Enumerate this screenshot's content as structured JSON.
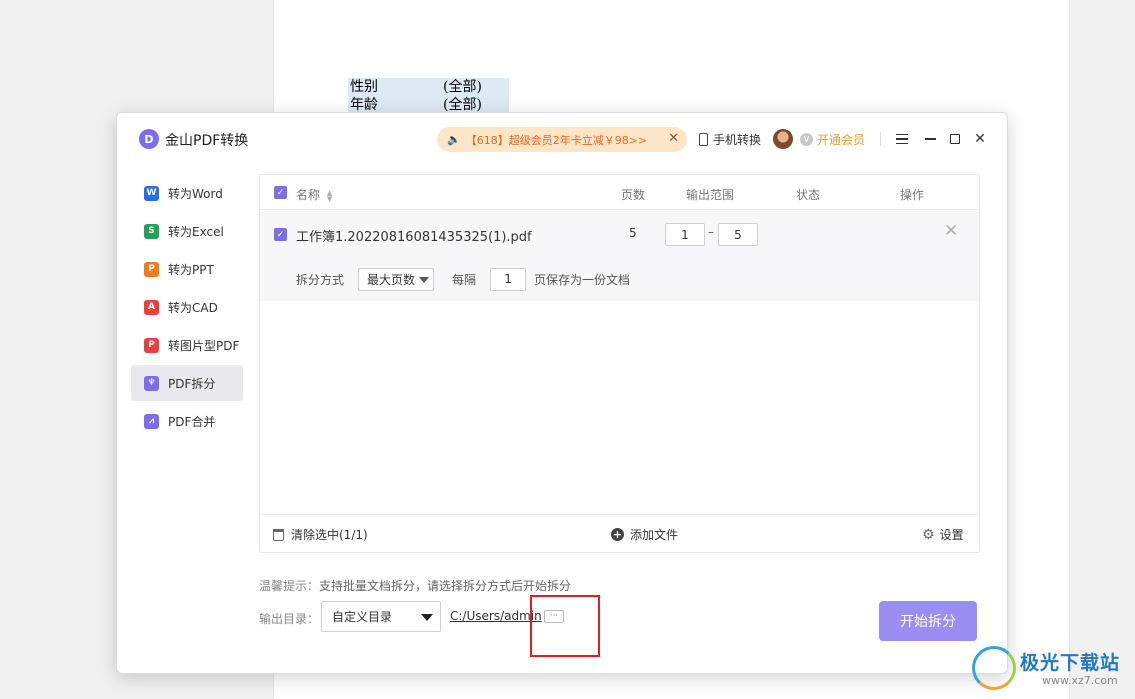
{
  "document": {
    "rows": [
      {
        "label": "性别",
        "value": "(全部)"
      },
      {
        "label": "年龄",
        "value": "(全部)"
      }
    ]
  },
  "app": {
    "logo_letter": "D",
    "title": "金山PDF转换",
    "promo_text": "【618】超级会员2年卡立减￥98>>",
    "mobile_label": "手机转换",
    "vip_label": "开通会员",
    "vip_icon_glyph": "V"
  },
  "sidebar": {
    "items": [
      {
        "label": "转为Word",
        "icon": "W",
        "color": "#2b6de8"
      },
      {
        "label": "转为Excel",
        "icon": "S",
        "color": "#1fa35a"
      },
      {
        "label": "转为PPT",
        "icon": "P",
        "color": "#f07a1c"
      },
      {
        "label": "转为CAD",
        "icon": "A",
        "color": "#e8413b"
      },
      {
        "label": "转图片型PDF",
        "icon": "P",
        "color": "#e8413b"
      },
      {
        "label": "PDF拆分",
        "icon": "♆",
        "color": "#7c6ee6"
      },
      {
        "label": "PDF合并",
        "icon": "⩘",
        "color": "#7c6ee6"
      }
    ],
    "active_index": 5
  },
  "table": {
    "headers": {
      "name": "名称",
      "pages": "页数",
      "range": "输出范围",
      "status": "状态",
      "action": "操作"
    },
    "files": [
      {
        "name": "工作簿1.20220816081435325(1).pdf",
        "pages": "5",
        "range_from": "1",
        "range_to": "5"
      }
    ],
    "range_dash": "–",
    "split": {
      "label": "拆分方式",
      "mode": "最大页数",
      "every_label": "每隔",
      "every_value": "1",
      "every_suffix": "页保存为一份文档"
    },
    "footer": {
      "clear": "清除选中(1/1)",
      "add": "添加文件",
      "settings": "设置"
    }
  },
  "bottom": {
    "hint_label": "温馨提示：",
    "hint_text": "支持批量文档拆分，请选择拆分方式后开始拆分",
    "output_label": "输出目录：",
    "output_mode": "自定义目录",
    "output_path": "C:/Users/admin",
    "browse": "···",
    "start": "开始拆分"
  },
  "watermark": {
    "title": "极光下载站",
    "url": "www.xz7.com"
  },
  "colors": {
    "accent": "#7c6ee6",
    "start_button": "#9b8ef2",
    "promo_bg": "#fde6c8",
    "promo_text": "#e0691e",
    "vip": "#e7a133",
    "annotation": "#e02020"
  }
}
